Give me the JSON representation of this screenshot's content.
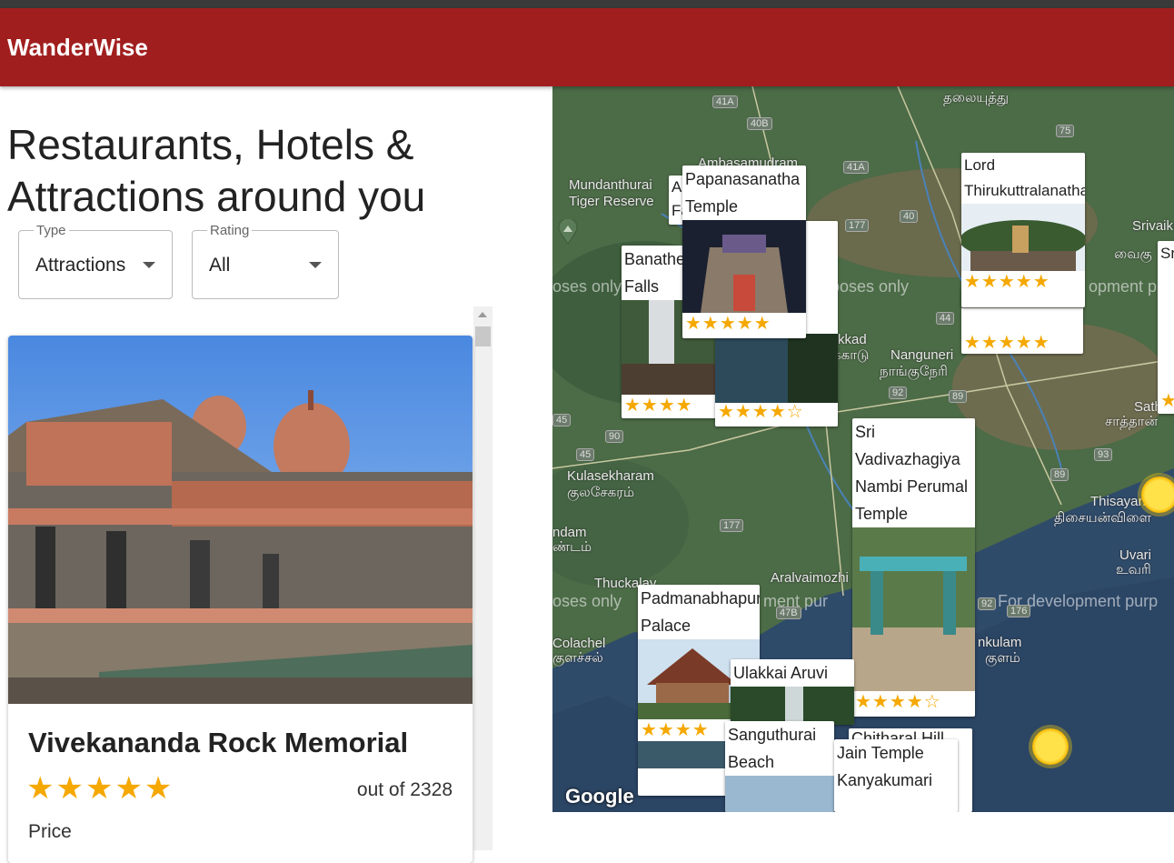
{
  "app": {
    "title": "WanderWise"
  },
  "headline": "Restaurants, Hotels & Attractions around you",
  "filters": {
    "type": {
      "label": "Type",
      "value": "Attractions"
    },
    "rating": {
      "label": "Rating",
      "value": "All"
    }
  },
  "featured": {
    "title": "Vivekananda Rock Memorial",
    "rating": 5,
    "stars": "★★★★★",
    "count": "out of 2328",
    "price_label": "Price"
  },
  "map": {
    "attribution": "Google",
    "dev_watermark": "For development purposes only",
    "dev_fragments": [
      "oses only",
      "urposes only",
      "opment pu",
      "oses only",
      "ment pur",
      "For development purp"
    ],
    "labels": [
      {
        "text": "Mundanthurai",
        "sub": "Tiger Reserve"
      },
      {
        "text": "Ambasamudram"
      },
      {
        "text": "தலையுத்து"
      },
      {
        "text": "Srivaikun"
      },
      {
        "text": "வைகு"
      },
      {
        "text": "Kulasekharam"
      },
      {
        "text": "குலசேகரம்"
      },
      {
        "text": "Nanguneri"
      },
      {
        "text": "நாங்குநேரி"
      },
      {
        "text": "Thisayanvi"
      },
      {
        "text": "திசையன்விளை"
      },
      {
        "text": "Uvari"
      },
      {
        "text": "உவரி"
      },
      {
        "text": "Aralvaimozhi"
      },
      {
        "text": "Thuckalay"
      },
      {
        "text": "Colachel"
      },
      {
        "text": "குளச்சல்"
      },
      {
        "text": "Satha"
      },
      {
        "text": "சாத்தான்"
      },
      {
        "text": "nkulam"
      },
      {
        "text": "குளம்"
      },
      {
        "text": "ndam"
      },
      {
        "text": "ண்டம்"
      },
      {
        "text": "க்காடு"
      },
      {
        "text": "kkad"
      }
    ],
    "roads": [
      "41A",
      "40B",
      "41A",
      "75",
      "177",
      "40",
      "44",
      "92",
      "89",
      "45",
      "90",
      "45",
      "93",
      "89",
      "92",
      "176",
      "47B",
      "177"
    ],
    "pins": [
      {
        "name": "Papanasanatha Temple",
        "stars": "★★★★★"
      },
      {
        "name": "Lord Thirukuttralanathar",
        "stars": "★★★★★"
      },
      {
        "name": "Banatheertham Falls",
        "stars": "★★★★"
      },
      {
        "name": "",
        "stars": "★★★★☆"
      },
      {
        "name": "",
        "stars": "★★★★★"
      },
      {
        "name": "Sri Vadivazhagiya Nambi Perumal Temple",
        "stars": "★★★★☆"
      },
      {
        "name": "Padmanabhapuram Palace",
        "stars": "★★★★"
      },
      {
        "name": "Ulakkai Aruvi",
        "stars": ""
      },
      {
        "name": "Sanguthurai Beach",
        "stars": "★★★★"
      },
      {
        "name": "Chitharal Hill",
        "stars": ""
      },
      {
        "name": "Jain Temple Kanyakumari",
        "stars": ""
      },
      {
        "name": "Sri Te",
        "stars": "★"
      },
      {
        "name": "Ac Fa",
        "stars": ""
      }
    ]
  },
  "colors": {
    "appbar": "#a11e1e",
    "star": "#f5a800",
    "map_land": "#4b6b46",
    "map_sea": "#2f4b6a"
  }
}
